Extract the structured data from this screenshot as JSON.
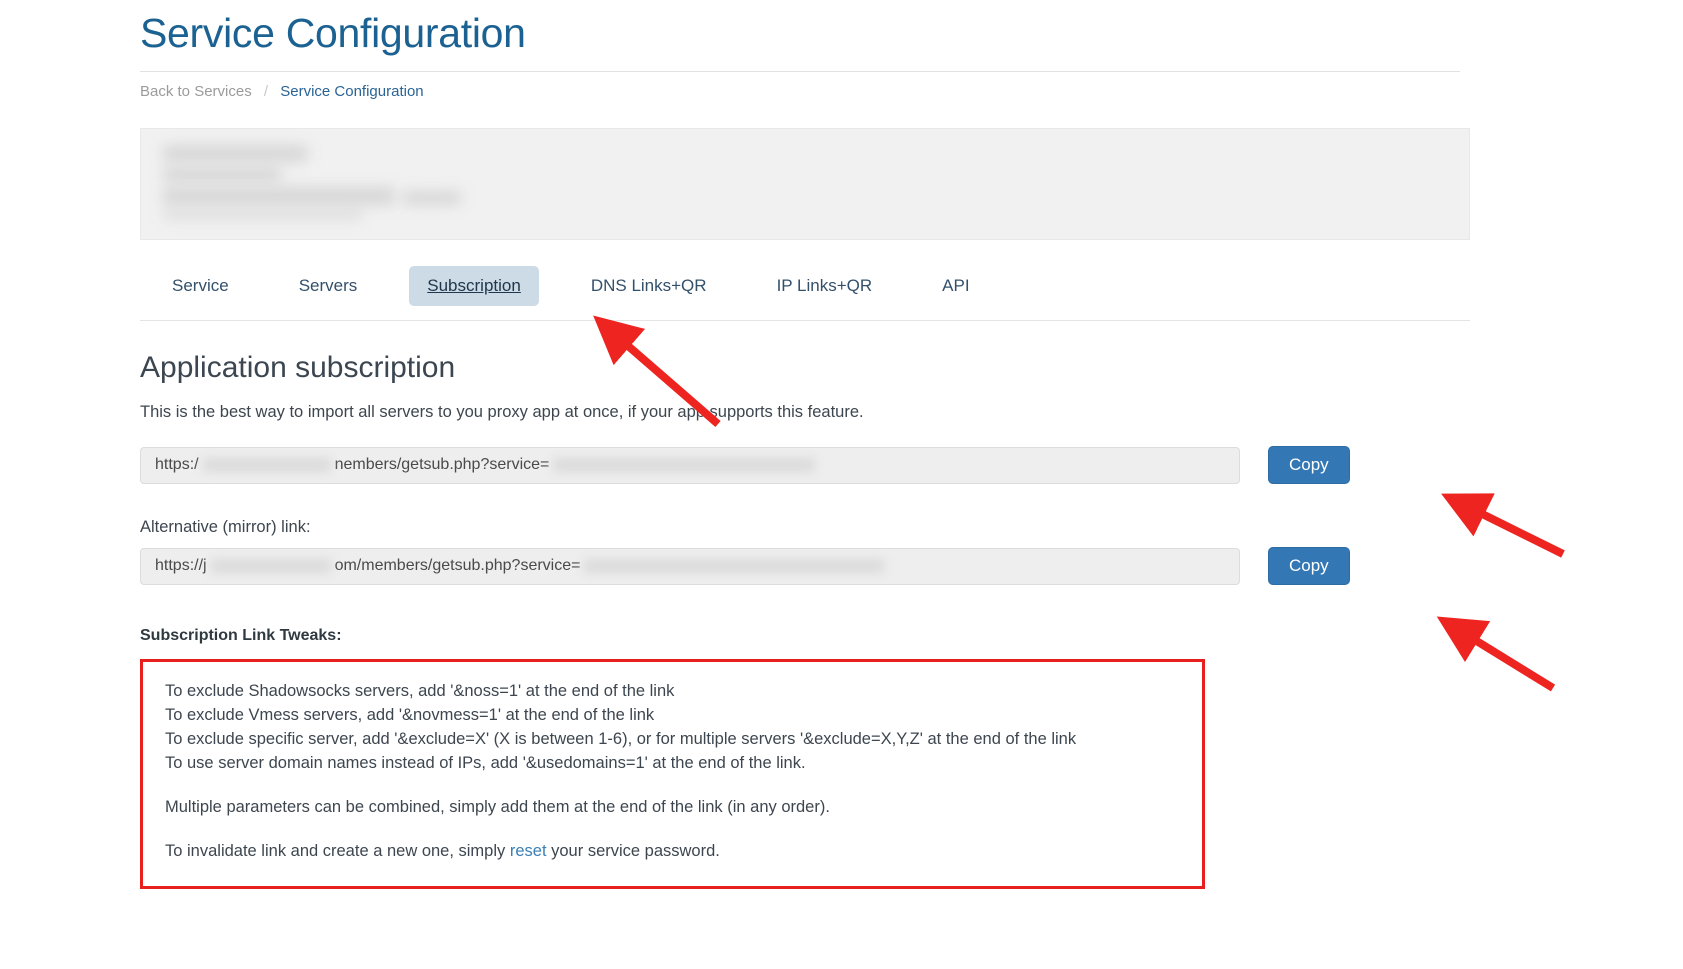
{
  "header": {
    "title": "Service Configuration",
    "breadcrumb": {
      "back": "Back to Services",
      "separator": "/",
      "current": "Service Configuration"
    }
  },
  "tabs": [
    {
      "label": "Service",
      "active": false
    },
    {
      "label": "Servers",
      "active": false
    },
    {
      "label": "Subscription",
      "active": true
    },
    {
      "label": "DNS Links+QR",
      "active": false
    },
    {
      "label": "IP Links+QR",
      "active": false
    },
    {
      "label": "API",
      "active": false
    }
  ],
  "section": {
    "title": "Application subscription",
    "description": "This is the best way to import all servers to you proxy app at once, if your app supports this feature."
  },
  "primary_link": {
    "prefix": "https:/",
    "middle": "nembers/getsub.php?service=",
    "copy_label": "Copy"
  },
  "mirror_link": {
    "label": "Alternative (mirror) link:",
    "prefix": "https://j",
    "middle": "om/members/getsub.php?service=",
    "copy_label": "Copy"
  },
  "tweaks": {
    "title": "Subscription Link Tweaks:",
    "lines": [
      "To exclude Shadowsocks servers, add '&noss=1' at the end of the link",
      "To exclude Vmess servers, add '&novmess=1' at the end of the link",
      "To exclude specific server, add '&exclude=X' (X is between 1-6), or for multiple servers '&exclude=X,Y,Z' at the end of the link",
      "To use server domain names instead of IPs, add '&usedomains=1' at the end of the link."
    ],
    "combined_note": "Multiple parameters can be combined, simply add them at the end of the link (in any order).",
    "invalidate_prefix": "To invalidate link and create a new one, simply ",
    "invalidate_link": "reset",
    "invalidate_suffix": " your service password."
  },
  "colors": {
    "title_blue": "#1b6292",
    "accent_button": "#3377b5",
    "annotation_red": "#e8201d",
    "active_tab_bg": "#ccdbe5"
  }
}
